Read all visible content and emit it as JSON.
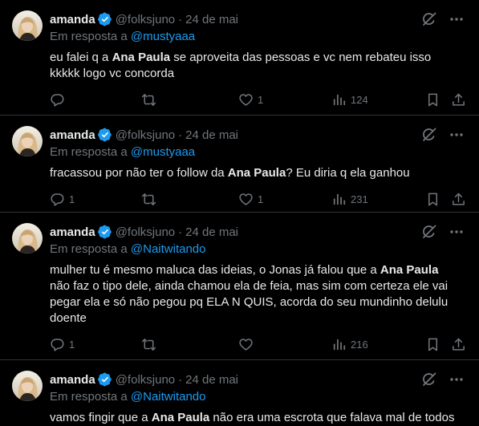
{
  "tweets": [
    {
      "name": "amanda",
      "handle": "@folksjuno",
      "dot": "·",
      "date": "24 de mai",
      "reply_prefix": "Em resposta a ",
      "reply_to": "@mustyaaa",
      "line1_a": "eu falei q a ",
      "line1_bold": "Ana Paula",
      "line1_b": " se aproveita das pessoas e vc nem rebateu isso",
      "line2": "kkkkk logo vc concorda",
      "reply_count": "",
      "like_count": "1",
      "view_count": "124"
    },
    {
      "name": "amanda",
      "handle": "@folksjuno",
      "dot": "·",
      "date": "24 de mai",
      "reply_prefix": "Em resposta a ",
      "reply_to": "@mustyaaa",
      "line1_a": "fracassou por não ter o follow da ",
      "line1_bold": "Ana Paula",
      "line1_b": "? Eu diria q ela ganhou",
      "reply_count": "1",
      "like_count": "1",
      "view_count": "231"
    },
    {
      "name": "amanda",
      "handle": "@folksjuno",
      "dot": "·",
      "date": "24 de mai",
      "reply_prefix": "Em resposta a ",
      "reply_to": "@Naitwitando",
      "line1_a": "mulher tu é mesmo maluca das ideias, o Jonas já falou que a ",
      "line1_bold": "Ana Paula",
      "line2": "não faz o tipo dele, ainda chamou ela de feia, mas sim com certeza ele vai",
      "line3": "pegar ela e só não pegou pq ELA N QUIS, acorda do seu mundinho delulu",
      "line4": "doente",
      "reply_count": "1",
      "like_count": "",
      "view_count": "216"
    },
    {
      "name": "amanda",
      "handle": "@folksjuno",
      "dot": "·",
      "date": "24 de mai",
      "reply_prefix": "Em resposta a ",
      "reply_to": "@Naitwitando",
      "line1_a": "vamos fingir que a ",
      "line1_bold": "Ana Paula",
      "line1_b": " não era uma escrota que falava mal de todos"
    }
  ],
  "colors": {
    "background": "#000000",
    "text": "#e7e9ea",
    "secondary": "#71767b",
    "link": "#1d9bf0",
    "border": "#2f3336"
  },
  "icons": [
    "verified-badge-icon",
    "grok-icon",
    "more-icon",
    "reply-icon",
    "retweet-icon",
    "like-icon",
    "views-icon",
    "bookmark-icon",
    "share-icon"
  ]
}
